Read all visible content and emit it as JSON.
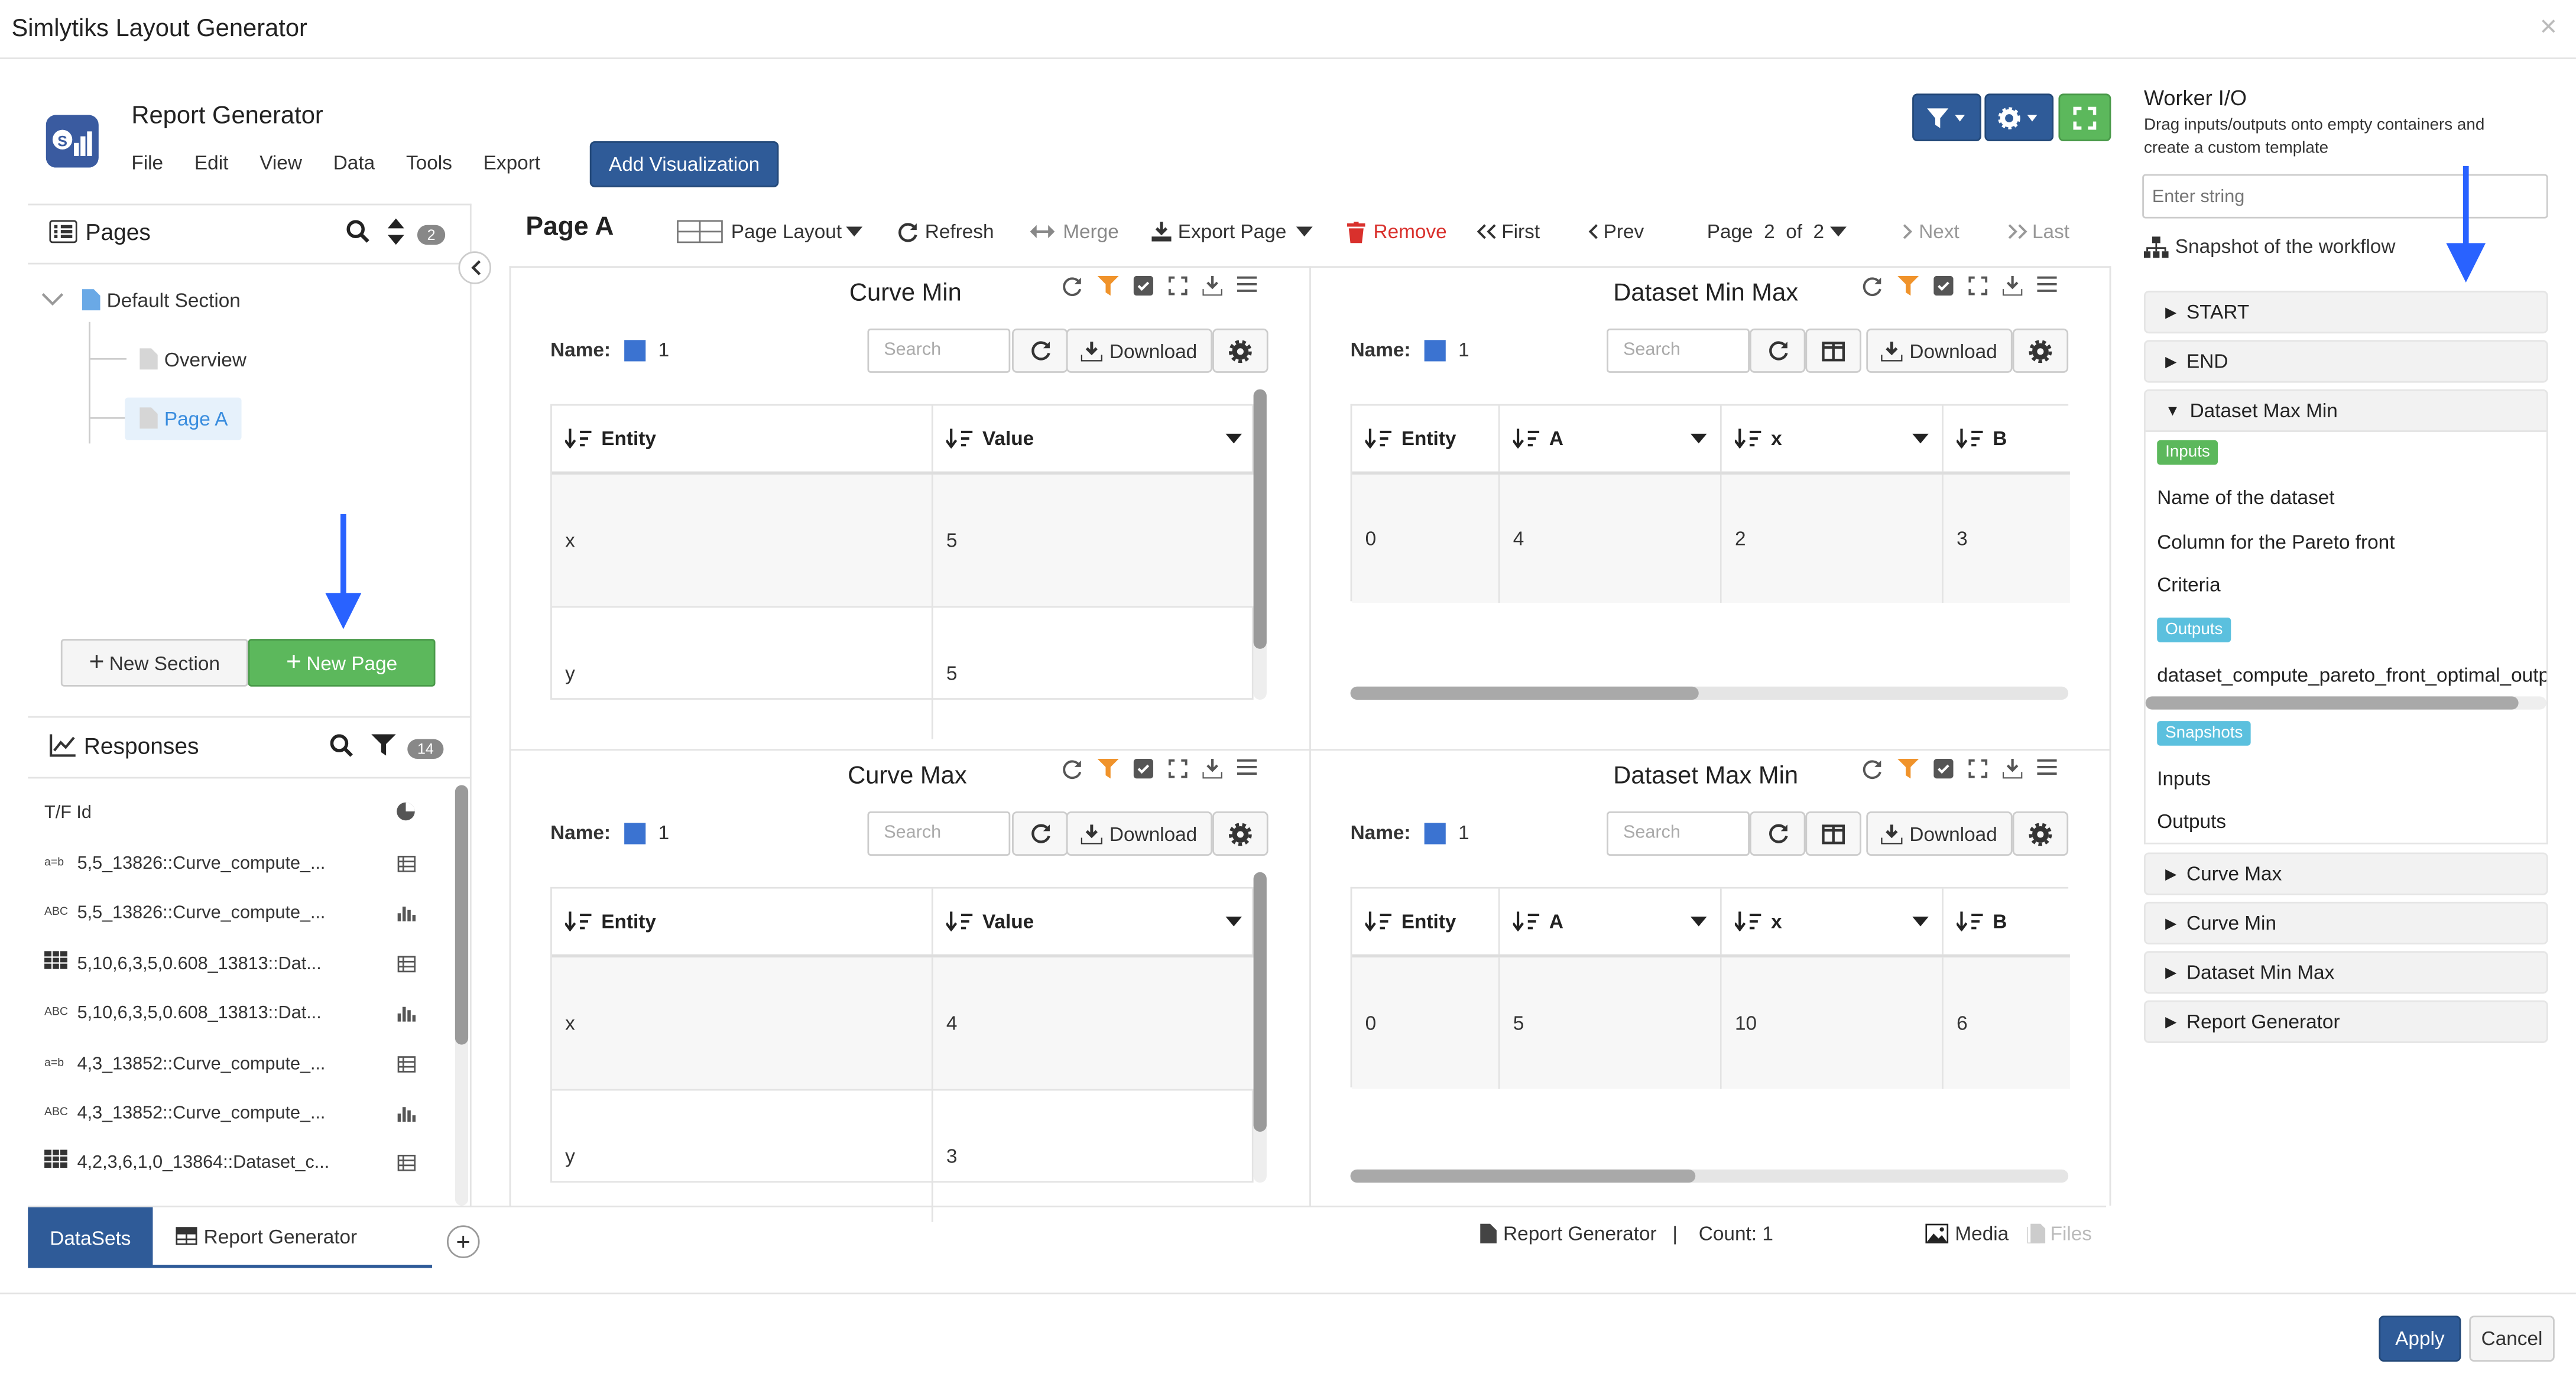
{
  "window": {
    "title": "Simlytiks Layout Generator",
    "close_glyph": "×"
  },
  "header": {
    "title": "Report Generator",
    "menu": [
      "File",
      "Edit",
      "View",
      "Data",
      "Tools",
      "Export"
    ],
    "add_visualization": "Add Visualization"
  },
  "pages": {
    "heading": "Pages",
    "count": "2",
    "section": "Default Section",
    "items": [
      "Overview",
      "Page A"
    ],
    "new_section": "New Section",
    "new_page": "New Page"
  },
  "responses": {
    "heading": "Responses",
    "count": "14",
    "column": "T/F Id",
    "rows": [
      {
        "tag": "a=b",
        "text": "5,5_13826::Curve_compute_..."
      },
      {
        "tag": "ABC",
        "text": "5,5_13826::Curve_compute_..."
      },
      {
        "tag": "grid",
        "text": "5,10,6,3,5,0.608_13813::Dat..."
      },
      {
        "tag": "ABC",
        "text": "5,10,6,3,5,0.608_13813::Dat..."
      },
      {
        "tag": "a=b",
        "text": "4,3_13852::Curve_compute_..."
      },
      {
        "tag": "ABC",
        "text": "4,3_13852::Curve_compute_..."
      },
      {
        "tag": "grid",
        "text": "4,2,3,6,1,0_13864::Dataset_c..."
      }
    ]
  },
  "tabs": {
    "datasets": "DataSets",
    "report": "Report Generator"
  },
  "toolbar": {
    "page_title": "Page A",
    "page_layout": "Page Layout",
    "refresh": "Refresh",
    "merge": "Merge",
    "export_page": "Export Page",
    "remove": "Remove",
    "first": "First",
    "prev": "Prev",
    "page_indicator": "Page  2  of  2",
    "next": "Next",
    "last": "Last"
  },
  "panels": {
    "name_label": "Name:",
    "search_placeholder": "Search",
    "download": "Download",
    "curve_min": {
      "title": "Curve Min",
      "name_value": "1",
      "columns": [
        "Entity",
        "Value"
      ],
      "rows": [
        [
          "x",
          "5"
        ],
        [
          "y",
          "5"
        ]
      ]
    },
    "dataset_min_max": {
      "title": "Dataset Min Max",
      "name_value": "1",
      "columns": [
        "Entity",
        "A",
        "x",
        "B"
      ],
      "rows": [
        [
          "0",
          "4",
          "2",
          "3"
        ]
      ]
    },
    "curve_max": {
      "title": "Curve Max",
      "name_value": "1",
      "columns": [
        "Entity",
        "Value"
      ],
      "rows": [
        [
          "x",
          "4"
        ],
        [
          "y",
          "3"
        ]
      ]
    },
    "dataset_max_min": {
      "title": "Dataset Max Min",
      "name_value": "1",
      "columns": [
        "Entity",
        "A",
        "x",
        "B"
      ],
      "rows": [
        [
          "0",
          "5",
          "10",
          "6"
        ]
      ]
    }
  },
  "status": {
    "report": "Report Generator",
    "separator": "|",
    "count": "Count: 1",
    "media": "Media",
    "files": "Files"
  },
  "worker_io": {
    "title": "Worker I/O",
    "description_line1": "Drag inputs/outputs onto empty containers and",
    "description_line2": "create a custom template",
    "input_placeholder": "Enter string",
    "snapshot_label": "Snapshot of the workflow",
    "accordion": {
      "start": "START",
      "end": "END",
      "dataset_max_min": "Dataset Max Min",
      "curve_max": "Curve Max",
      "curve_min": "Curve Min",
      "dataset_min_max": "Dataset Min Max",
      "report_generator": "Report Generator"
    },
    "inputs_badge": "Inputs",
    "inputs": [
      "Name of the dataset",
      "Column for the Pareto front",
      "Criteria"
    ],
    "outputs_badge": "Outputs",
    "outputs": [
      "dataset_compute_pareto_front_optimal_output"
    ],
    "snapshots_badge": "Snapshots",
    "snapshots": [
      "Inputs",
      "Outputs"
    ]
  },
  "footer": {
    "apply": "Apply",
    "cancel": "Cancel"
  },
  "colors": {
    "primary": "#2f5b98",
    "success": "#5cb85c",
    "danger": "#d9302c",
    "filter": "#f0932b",
    "arrow": "#2962ff"
  }
}
